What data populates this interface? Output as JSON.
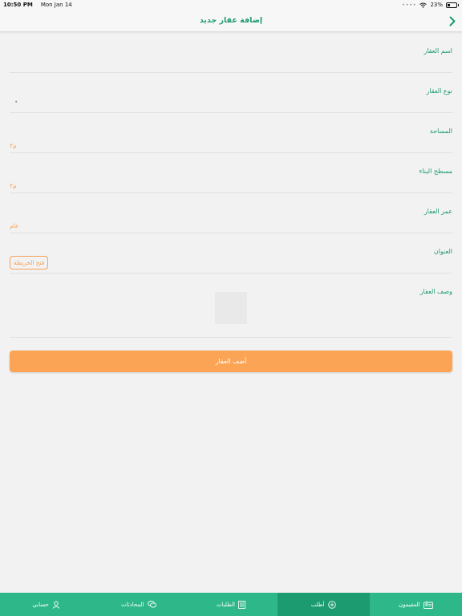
{
  "status_bar": {
    "time": "10:50 PM",
    "date": "Mon Jan 14",
    "battery": "23%"
  },
  "header": {
    "title": "إضافة عقار جديد"
  },
  "form": {
    "fields": [
      {
        "label": "اسم العقار",
        "unit": ""
      },
      {
        "label": "نوع العقار",
        "unit": ""
      },
      {
        "label": "المساحة",
        "unit": "م٢"
      },
      {
        "label": "مسطح البناء",
        "unit": "م٢"
      },
      {
        "label": "عمر العقار",
        "unit": "عام"
      },
      {
        "label": "العنوان",
        "unit": ""
      },
      {
        "label": "وصف العقار",
        "unit": ""
      }
    ],
    "map_button": "فتح الخريطة",
    "type_indicator": "•",
    "submit_label": "أضف العقار"
  },
  "tabs": [
    {
      "label": "حسابي",
      "icon": "user-icon"
    },
    {
      "label": "المحادثات",
      "icon": "chat-icon"
    },
    {
      "label": "الطلبات",
      "icon": "list-icon"
    },
    {
      "label": "أطلب",
      "icon": "plus-circle-icon"
    },
    {
      "label": "المقيمون",
      "icon": "residents-icon"
    }
  ],
  "colors": {
    "primary_green": "#1c9a6c",
    "tab_green": "#2eb88a",
    "tab_active": "#1d9b70",
    "accent_orange": "#fca456"
  }
}
